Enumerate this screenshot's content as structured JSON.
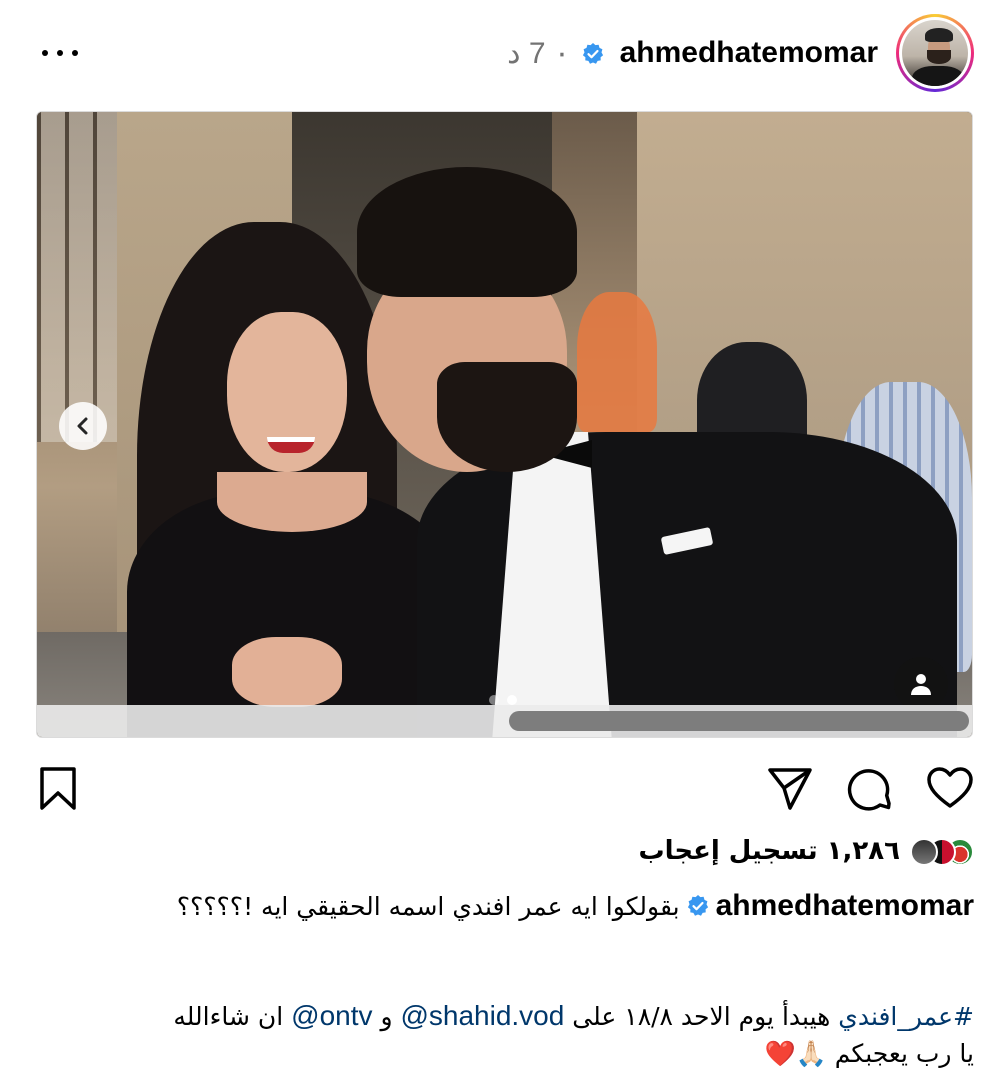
{
  "post": {
    "username": "ahmedhatemomar",
    "time": "٠ 7 د",
    "more_icon": "more-horizontal-icon"
  },
  "media": {
    "prev_icon": "chevron-left-icon",
    "tags_icon": "user-tag-icon",
    "carousel_total": 2,
    "carousel_current": 2
  },
  "actions": {
    "like_icon": "heart-icon",
    "comment_icon": "comment-icon",
    "share_icon": "send-icon",
    "save_icon": "bookmark-icon"
  },
  "likes": {
    "text": "١,٢٨٦ تسجيل إعجاب"
  },
  "caption": {
    "username": "ahmedhatemomar",
    "line1": "بقولكوا ايه عمر افندي اسمه الحقيقي ايه !؟؟؟؟؟",
    "hashtag": "#عمر_افندي",
    "line2_a": " هيبدأ يوم الاحد ١٨/٨ على ",
    "mention1": "@shahid.vod",
    "line2_b": " و ",
    "mention2": "@ontv",
    "line2_c": " ان شاءالله",
    "line3": "يا رب يعجبكم 🙏🏻❤️"
  },
  "colors": {
    "link": "#00376b",
    "verified": "#3897f0",
    "muted": "#737373"
  }
}
